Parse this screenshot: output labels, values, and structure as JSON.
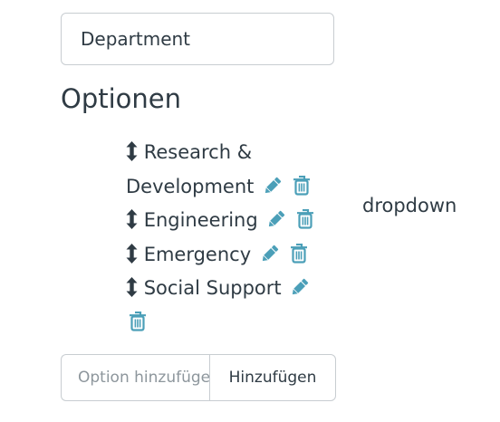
{
  "field": {
    "name_value": "Department",
    "type_label": "dropdown"
  },
  "options_section": {
    "title": "Optionen",
    "items": [
      {
        "label": "Research & Development"
      },
      {
        "label": "Engineering"
      },
      {
        "label": "Emergency"
      },
      {
        "label": "Social Support"
      }
    ]
  },
  "add_option": {
    "placeholder": "Option hinzufügen",
    "button_label": "Hinzufügen"
  },
  "icons": {
    "drag": "sort-vertical-icon",
    "edit": "pencil-icon",
    "delete": "trash-icon"
  },
  "colors": {
    "text": "#2f3b44",
    "icon_accent": "#4b9fb8",
    "border": "#c8cdd1"
  }
}
